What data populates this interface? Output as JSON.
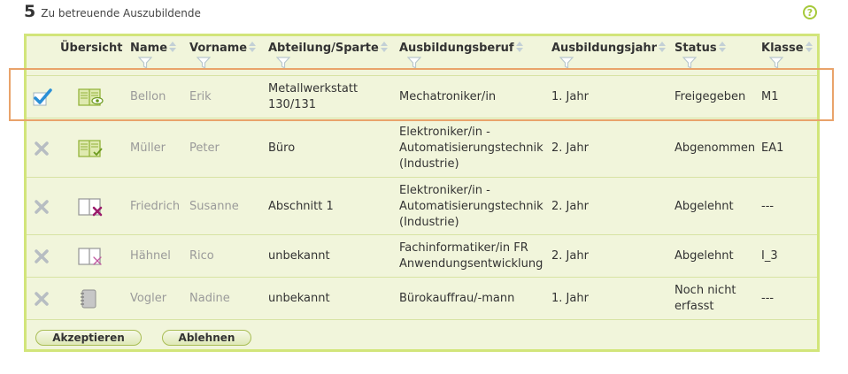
{
  "header": {
    "count": "5",
    "title": "Zu betreuende Auszubildende",
    "help": "?"
  },
  "columns": [
    {
      "key": "overview",
      "label": "Übersicht"
    },
    {
      "key": "name",
      "label": "Name"
    },
    {
      "key": "vorname",
      "label": "Vorname"
    },
    {
      "key": "abteilung",
      "label": "Abteilung/Sparte"
    },
    {
      "key": "beruf",
      "label": "Ausbildungsberuf"
    },
    {
      "key": "jahr",
      "label": "Ausbildungsjahr"
    },
    {
      "key": "status",
      "label": "Status"
    },
    {
      "key": "klasse",
      "label": "Klasse"
    }
  ],
  "rows": [
    {
      "checked": true,
      "icon": "book-eye-icon",
      "name": "Bellon",
      "vorname": "Erik",
      "abteilung": [
        "Metallwerkstatt",
        "130/131"
      ],
      "beruf": [
        "Mechatroniker/in"
      ],
      "jahr": "1. Jahr",
      "status": [
        "Freigegeben"
      ],
      "klasse": "M1"
    },
    {
      "checked": false,
      "icon": "book-check-icon",
      "name": "Müller",
      "vorname": "Peter",
      "abteilung": [
        "Büro"
      ],
      "beruf": [
        "Elektroniker/in -",
        "Automatisierungstechnik",
        "(Industrie)"
      ],
      "jahr": "2. Jahr",
      "status": [
        "Abgenommen"
      ],
      "klasse": "EA1"
    },
    {
      "checked": false,
      "icon": "book-rejected-icon",
      "name": "Friedrich",
      "vorname": "Susanne",
      "abteilung": [
        "Abschnitt 1"
      ],
      "beruf": [
        "Elektroniker/in -",
        "Automatisierungstechnik",
        "(Industrie)"
      ],
      "jahr": "2. Jahr",
      "status": [
        "Abgelehnt"
      ],
      "klasse": "---"
    },
    {
      "checked": false,
      "icon": "book-rejected-outline-icon",
      "name": "Hähnel",
      "vorname": "Rico",
      "abteilung": [
        "unbekannt"
      ],
      "beruf": [
        "Fachinformatiker/in FR",
        "Anwendungsentwicklung"
      ],
      "jahr": "2. Jahr",
      "status": [
        "Abgelehnt"
      ],
      "klasse": "I_3"
    },
    {
      "checked": false,
      "icon": "notebook-icon",
      "name": "Vogler",
      "vorname": "Nadine",
      "abteilung": [
        "unbekannt"
      ],
      "beruf": [
        "Bürokauffrau/-mann"
      ],
      "jahr": "1. Jahr",
      "status": [
        "Noch nicht",
        "erfasst"
      ],
      "klasse": "---"
    }
  ],
  "buttons": {
    "accept": "Akzeptieren",
    "reject": "Ablehnen"
  },
  "colors": {
    "panel_border": "#d2e57a",
    "panel_bg": "#f1f5db",
    "accent_green": "#a6c93a",
    "check_blue": "#2a8fd6",
    "reject_magenta": "#9b1b6b",
    "highlight": "#e9a36a"
  }
}
